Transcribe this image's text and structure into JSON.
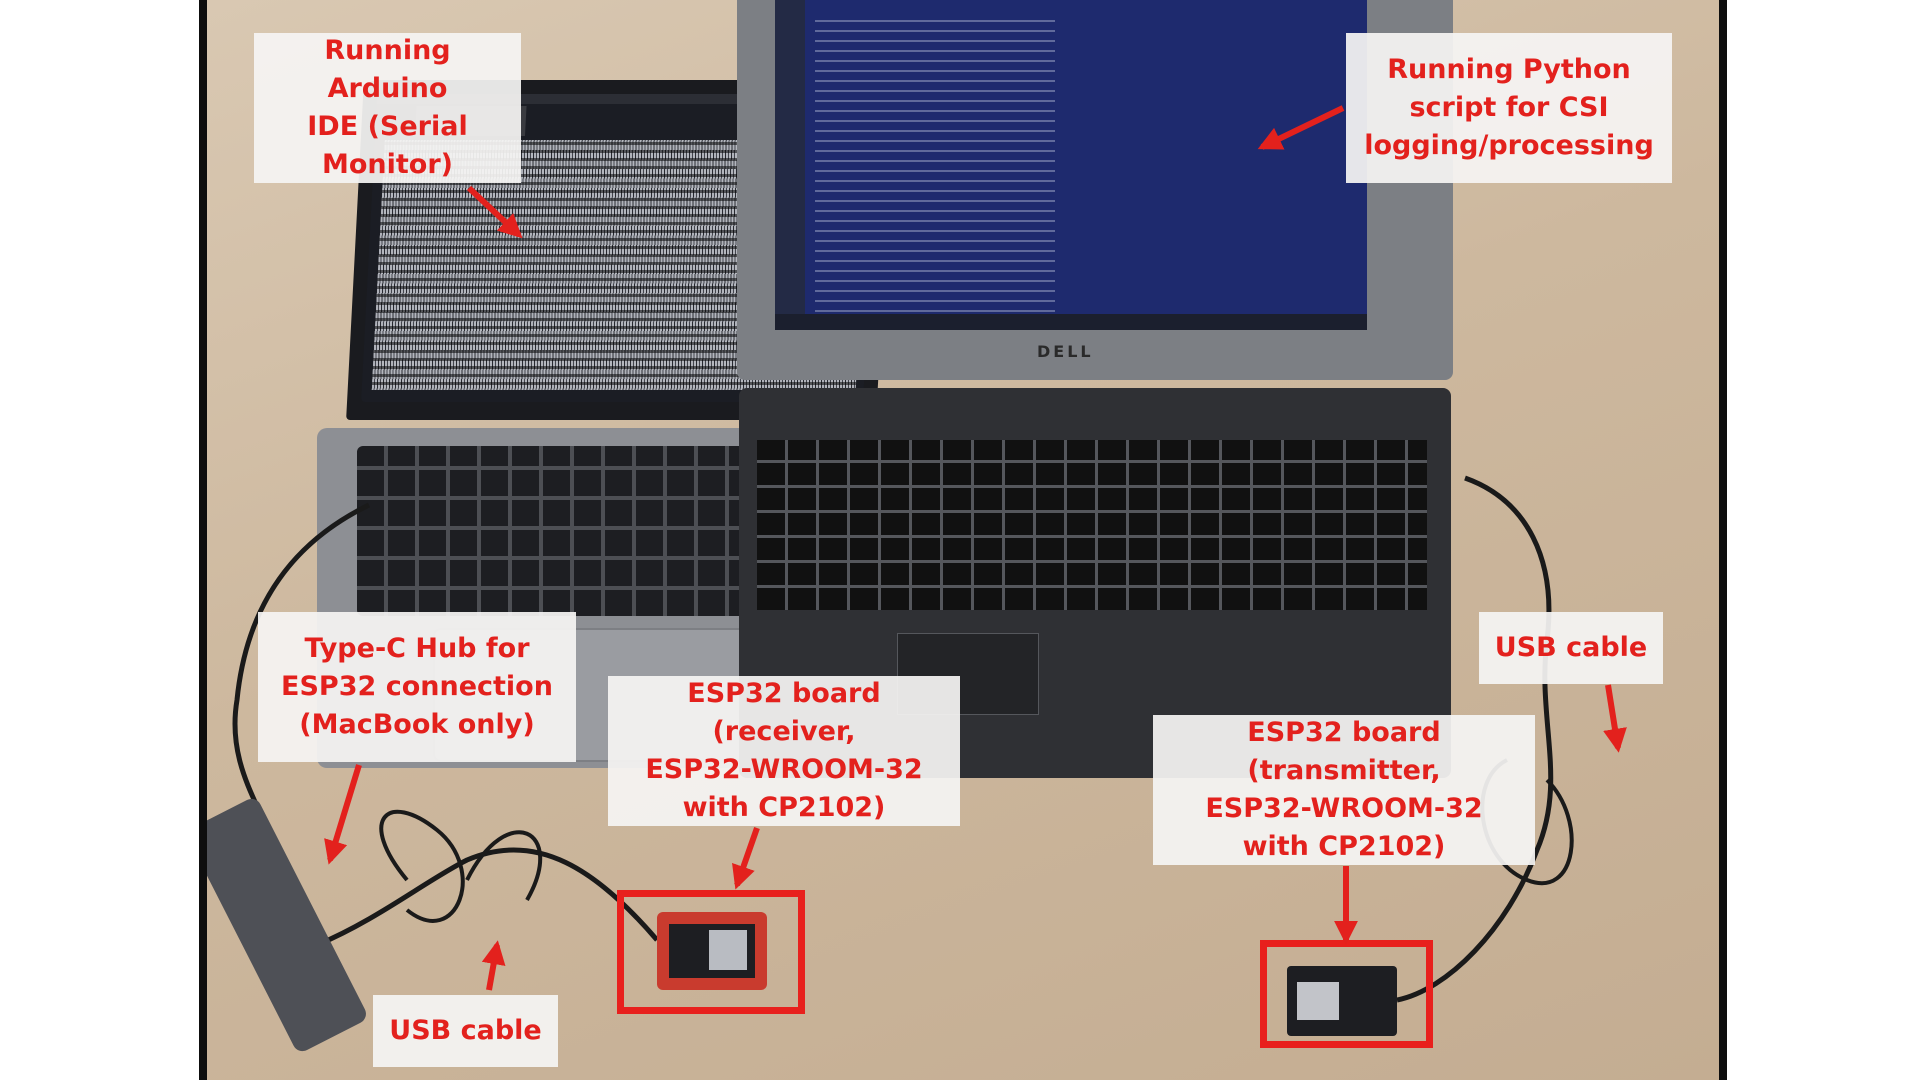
{
  "photo": {
    "labels": {
      "arduino": "Running Arduino\nIDE (Serial\nMonitor)",
      "python": "Running Python\nscript for CSI\nlogging/processing",
      "hub": "Type-C Hub for\nESP32 connection\n(MacBook only)",
      "receiver": "ESP32 board (receiver,\nESP32-WROOM-32\nwith CP2102)",
      "transmitter": "ESP32 board (transmitter,\nESP32-WROOM-32\nwith CP2102)",
      "usb_left": "USB cable",
      "usb_right": "USB cable"
    },
    "laptop_brand": "DELL",
    "colors": {
      "annotation": "#e3211d",
      "label_bg": "#f5f4f3"
    }
  }
}
